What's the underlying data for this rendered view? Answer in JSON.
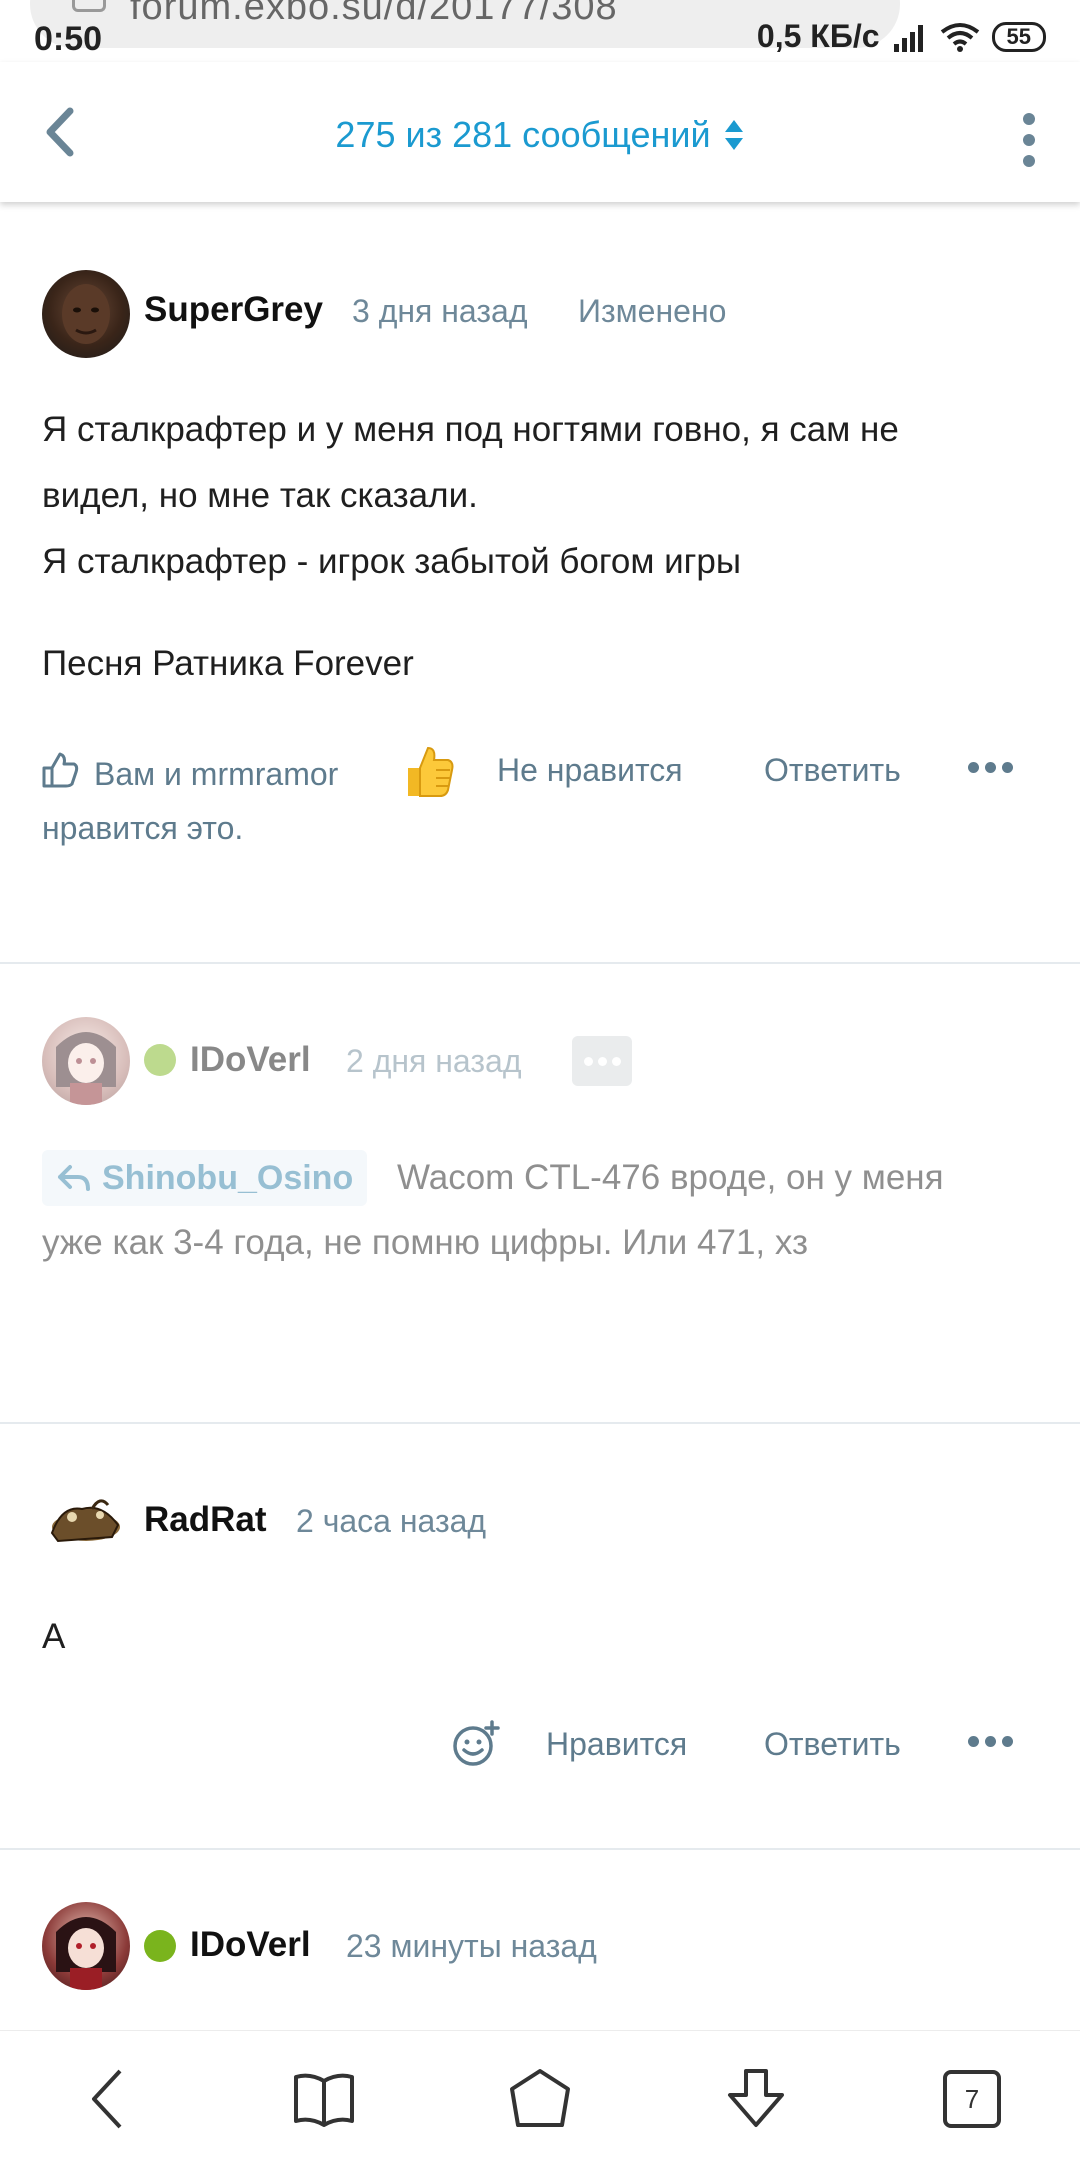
{
  "status_bar": {
    "time": "0:50",
    "net_speed": "0,5 КБ/с",
    "battery": "55",
    "url": "forum.exbo.su/d/20177/308"
  },
  "header": {
    "title": "275 из 281 сообщений"
  },
  "posts": [
    {
      "author": "SuperGrey",
      "time": "3 дня назад",
      "edited": "Изменено",
      "body_lines": [
        "Я сталкрафтер и у меня под ногтями говно, я сам не",
        "видел, но мне так сказали.",
        "Я сталкрафтер - игрок забытой богом игры"
      ],
      "body_extra": "Песня Ратника Forever",
      "likes_text_line1": "Вам и mrmramor",
      "likes_text_line2": "нравится это.",
      "dislike_label": "Не нравится",
      "reply_label": "Ответить"
    },
    {
      "author": "IDoVerl",
      "time": "2 дня назад",
      "reply_to": "Shinobu_Osino",
      "body_line1": "Wacom CTL-476 вроде, он у меня",
      "body_line2": "уже как 3-4 года, не помню цифры. Или 471, хз"
    },
    {
      "author": "RadRat",
      "time": "2 часа назад",
      "body": "А",
      "like_label": "Нравится",
      "reply_label": "Ответить"
    },
    {
      "author": "IDoVerl",
      "time": "23 минуты назад"
    }
  ],
  "bottom_nav": {
    "tabs_count": "7"
  },
  "colors": {
    "accent": "#1b9ad0",
    "meta": "#6e8899",
    "action": "#5e7b8d",
    "online": "#7ab41d"
  }
}
